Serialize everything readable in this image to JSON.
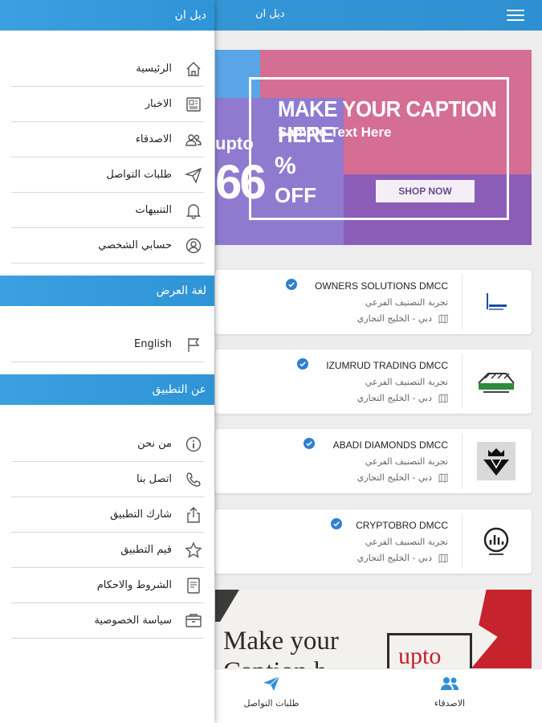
{
  "app": {
    "title": "ديل ان"
  },
  "drawer": {
    "header": "ديل ان",
    "main_items": [
      {
        "label": "الرئيسية",
        "icon": "home-icon"
      },
      {
        "label": "الاخبار",
        "icon": "news-icon"
      },
      {
        "label": "الاصدقاء",
        "icon": "friends-icon"
      },
      {
        "label": "طلبات التواصل",
        "icon": "send-icon"
      },
      {
        "label": "التنبيهات",
        "icon": "bell-icon"
      },
      {
        "label": "حسابي الشخصي",
        "icon": "profile-icon"
      }
    ],
    "language_section": "لغة العرض",
    "language_item": {
      "label": "English",
      "icon": "flag-icon"
    },
    "about_section": "عن التطبيق",
    "about_items": [
      {
        "label": "من نحن",
        "icon": "info-icon"
      },
      {
        "label": "اتصل بنا",
        "icon": "phone-icon"
      },
      {
        "label": "شارك التطبيق",
        "icon": "share-icon"
      },
      {
        "label": "قيم التطبيق",
        "icon": "star-icon"
      },
      {
        "label": "الشروط والاحكام",
        "icon": "document-icon"
      },
      {
        "label": "سياسة الخصوصية",
        "icon": "privacy-icon"
      }
    ]
  },
  "banner1": {
    "headline": "MAKE YOUR CAPTION HERE",
    "subheadline": "Sample Text Here",
    "upto": "upto",
    "percent": "66",
    "percent_sign": "%",
    "off": "OFF",
    "button": "SHOP NOW"
  },
  "companies": [
    {
      "name": "OWNERS SOLUTIONS DMCC",
      "category": "تجربة التصنيف الفرعي",
      "location": "دبي - الخليج التجاري",
      "logo": "owners-solutions-logo"
    },
    {
      "name": "IZUMRUD TRADING DMCC",
      "category": "تجربة التصنيف الفرعي",
      "location": "دبي - الخليج التجاري",
      "logo": "izumrud-logo"
    },
    {
      "name": "ABADI DIAMONDS DMCC",
      "category": "تجربة التصنيف الفرعي",
      "location": "دبي - الخليج التجاري",
      "logo": "abadi-logo"
    },
    {
      "name": "CRYPTOBRO DMCC",
      "category": "تجربة التصنيف الفرعي",
      "location": "دبي - الخليج التجاري",
      "logo": "cryptobro-logo"
    }
  ],
  "banner2": {
    "line1": "Make your",
    "line2": "Caption h",
    "upto": "upto"
  },
  "bottom_nav": [
    {
      "label": "طلبات التواصل",
      "icon": "send-icon"
    },
    {
      "label": "الاصدقاء",
      "icon": "friends-icon"
    }
  ],
  "colors": {
    "accent": "#2f94d6",
    "verified": "#2f7fd1"
  }
}
